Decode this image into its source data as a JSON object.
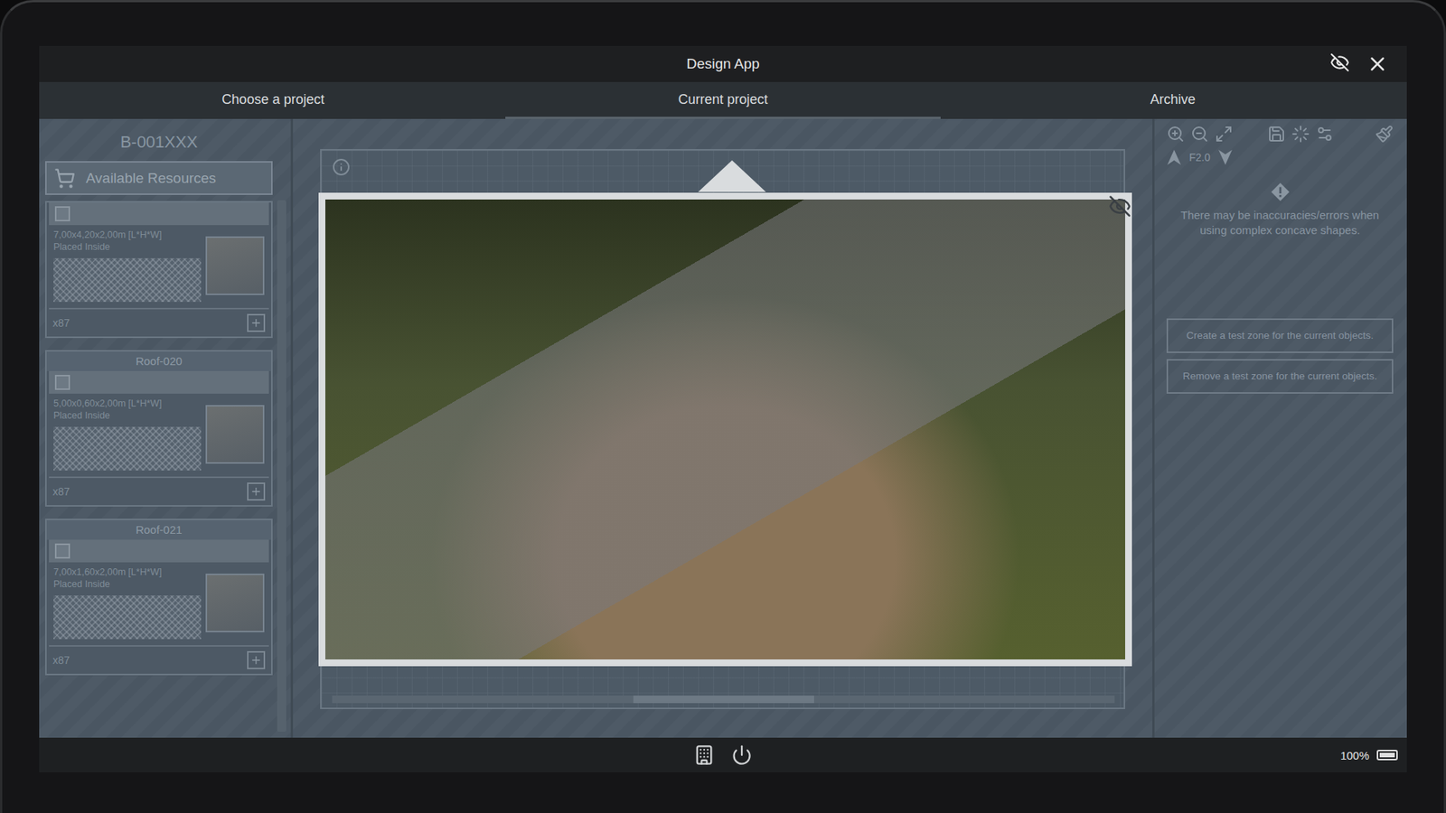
{
  "window": {
    "title": "Design App"
  },
  "tabs": [
    {
      "label": "Choose a project",
      "selected": false
    },
    {
      "label": "Current project",
      "selected": true
    },
    {
      "label": "Archive",
      "selected": false
    }
  ],
  "project": {
    "code": "B-001XXX"
  },
  "resources_button": {
    "label": "Available Resources"
  },
  "resources": [
    {
      "checked": false,
      "size": "7,00x4,20x2,00m [L*H*W]",
      "placement": "Placed Inside",
      "count": "x87"
    },
    {
      "name": "Roof-020",
      "checked": false,
      "size": "5,00x0,60x2,00m [L*H*W]",
      "placement": "Placed Inside",
      "count": "x87"
    },
    {
      "name": "Roof-021",
      "checked": false,
      "size": "7,00x1,60x2,00m [L*H*W]",
      "placement": "Placed Inside",
      "count": "x87"
    }
  ],
  "toolbar": {
    "floor": "F2.0"
  },
  "notice": "There may be inaccuracies/errors when using complex concave shapes.",
  "actions": [
    "Create a test zone for the current objects.",
    "Remove a test zone for the current objects."
  ],
  "status_bar": {
    "battery": "100%",
    "battery_level": 1
  }
}
